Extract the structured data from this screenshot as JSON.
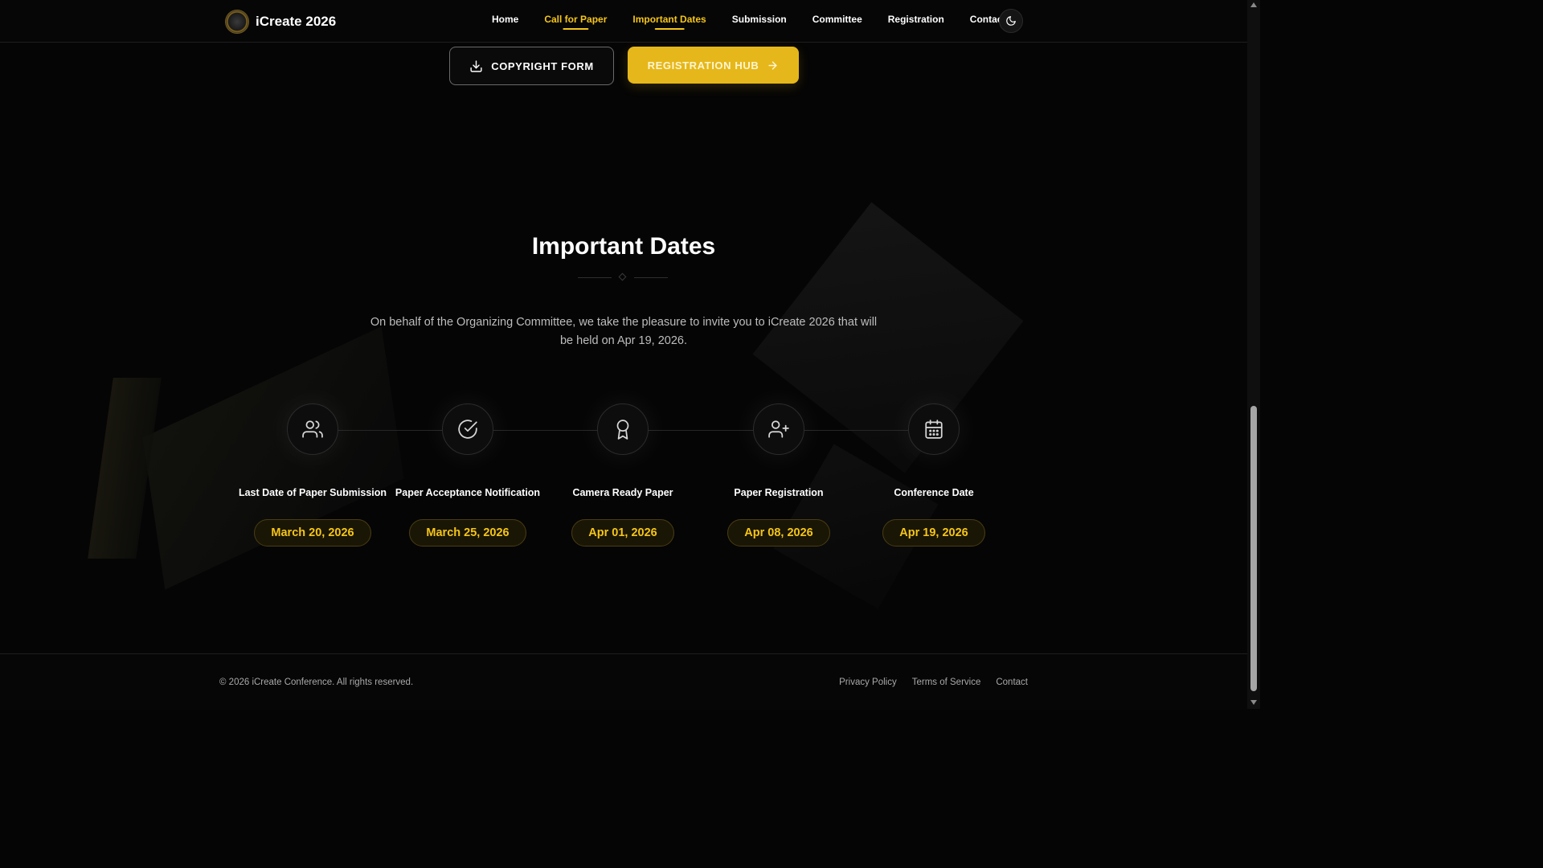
{
  "header": {
    "brand": "iCreate 2026",
    "nav": [
      {
        "label": "Home",
        "active": false
      },
      {
        "label": "Call for Paper",
        "active": true
      },
      {
        "label": "Important Dates",
        "active": true
      },
      {
        "label": "Submission",
        "active": false
      },
      {
        "label": "Committee",
        "active": false
      },
      {
        "label": "Registration",
        "active": false
      },
      {
        "label": "Contact",
        "active": false
      }
    ],
    "theme_icon": "moon-icon"
  },
  "actions": {
    "copyright_form": "COPYRIGHT FORM",
    "copyright_icon": "download-icon",
    "registration_hub": "REGISTRATION HUB",
    "registration_icon": "arrow-right-icon"
  },
  "section": {
    "title": "Important Dates",
    "intro": "On behalf of the Organizing Committee, we take the pleasure to invite you to iCreate 2026 that will be held on Apr 19, 2026."
  },
  "dates": [
    {
      "label": "Last Date of Paper Submission",
      "date": "March 20, 2026",
      "icon": "users-icon"
    },
    {
      "label": "Paper Acceptance Notification",
      "date": "March 25, 2026",
      "icon": "check-circle-icon"
    },
    {
      "label": "Camera Ready Paper",
      "date": "Apr 01, 2026",
      "icon": "award-icon"
    },
    {
      "label": "Paper Registration",
      "date": "Apr 08, 2026",
      "icon": "user-plus-icon"
    },
    {
      "label": "Conference Date",
      "date": "Apr 19, 2026",
      "icon": "calendar-icon"
    }
  ],
  "footer": {
    "copyright": "© 2026 iCreate Conference. All rights reserved.",
    "links": [
      "Privacy Policy",
      "Terms of Service",
      "Contact"
    ]
  },
  "colors": {
    "accent": "#f5c518",
    "button_primary": "#e6b71a",
    "background": "#050505"
  }
}
